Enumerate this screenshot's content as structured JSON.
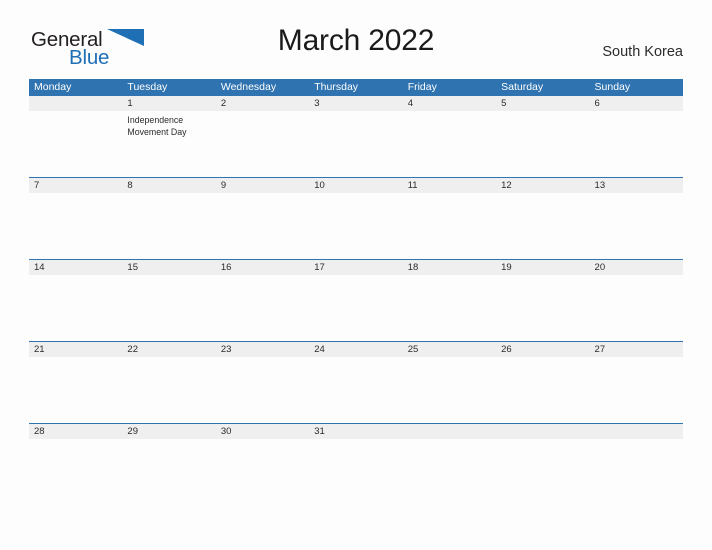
{
  "brand": {
    "name_part1": "General",
    "name_part2": "Blue",
    "flag_icon": "flag-triangle-icon",
    "color_dark": "#231f20",
    "color_blue": "#1f6fb5"
  },
  "header": {
    "title": "March 2022",
    "locale": "South Korea"
  },
  "theme": {
    "header_blue": "#2f73b0",
    "date_band_gray": "#efefef",
    "page_background": "#fdfdfd",
    "text_color": "#2b2b2b"
  },
  "calendar": {
    "weekdays": [
      "Monday",
      "Tuesday",
      "Wednesday",
      "Thursday",
      "Friday",
      "Saturday",
      "Sunday"
    ],
    "weeks": [
      {
        "dates": [
          "",
          "1",
          "2",
          "3",
          "4",
          "5",
          "6"
        ],
        "events": [
          "",
          "Independence Movement Day",
          "",
          "",
          "",
          "",
          ""
        ]
      },
      {
        "dates": [
          "7",
          "8",
          "9",
          "10",
          "11",
          "12",
          "13"
        ],
        "events": [
          "",
          "",
          "",
          "",
          "",
          "",
          ""
        ]
      },
      {
        "dates": [
          "14",
          "15",
          "16",
          "17",
          "18",
          "19",
          "20"
        ],
        "events": [
          "",
          "",
          "",
          "",
          "",
          "",
          ""
        ]
      },
      {
        "dates": [
          "21",
          "22",
          "23",
          "24",
          "25",
          "26",
          "27"
        ],
        "events": [
          "",
          "",
          "",
          "",
          "",
          "",
          ""
        ]
      },
      {
        "dates": [
          "28",
          "29",
          "30",
          "31",
          "",
          "",
          ""
        ],
        "events": [
          "",
          "",
          "",
          "",
          "",
          "",
          ""
        ]
      }
    ]
  }
}
